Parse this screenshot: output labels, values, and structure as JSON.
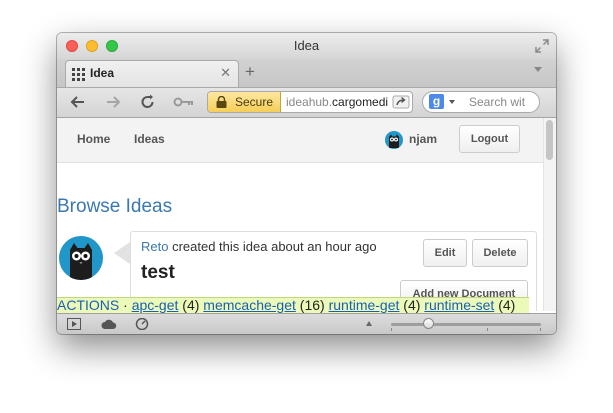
{
  "window": {
    "title": "Idea"
  },
  "tab": {
    "label": "Idea"
  },
  "toolbar": {
    "secure_label": "Secure",
    "url_prefix": "ideahub.",
    "url_domain": "cargomedi",
    "search_placeholder": "Search wit",
    "search_engine": "g"
  },
  "navbar": {
    "home": "Home",
    "ideas": "Ideas",
    "username": "njam",
    "logout": "Logout"
  },
  "page": {
    "title": "Browse Ideas"
  },
  "idea": {
    "author": "Reto",
    "meta_text": " created this idea about an hour ago",
    "title": "test",
    "edit": "Edit",
    "delete": "Delete",
    "add_document": "Add new Document"
  },
  "actions_bar": {
    "label": "ACTIONS",
    "separator": " · ",
    "items": [
      {
        "name": "apc-get",
        "count": "(4)"
      },
      {
        "name": "memcache-get",
        "count": "(16)"
      },
      {
        "name": "runtime-get",
        "count": "(4)"
      },
      {
        "name": "runtime-set",
        "count": "(4)"
      }
    ]
  },
  "statusbar": {
    "zoom_level": 0.25
  },
  "colors": {
    "link": "#3b78b0",
    "secure_bg": "#f6cf58",
    "actions_bg": "#ebf9b9",
    "avatar": "#2196c9"
  }
}
